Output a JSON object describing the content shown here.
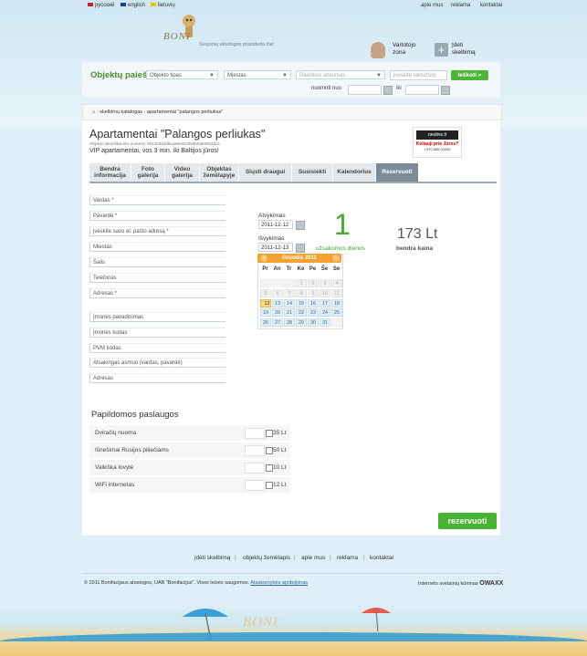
{
  "topbar": {
    "languages": [
      {
        "label": "русский",
        "color": "#cc2222"
      },
      {
        "label": "english",
        "color": "#1e3f8a"
      },
      {
        "label": "lietuvių",
        "color": "#f2c200"
      }
    ],
    "links": [
      "apie mus",
      "reklama",
      "kontaktai"
    ]
  },
  "logo": {
    "text": "BONI",
    "slogan": "Svajonių atostogos prasideda čia!"
  },
  "user": {
    "zone_line1": "Vartotojo",
    "zone_line2": "zona",
    "add_line1": "Įdėti",
    "add_line2": "skelbimą"
  },
  "search": {
    "title": "Objektų paieška",
    "object_type": "Objekto tipas",
    "city": "Miestas",
    "distance": "Paieškos atstumas",
    "keyword_placeholder": "įveskite raktažodį",
    "button": "Ieškoti",
    "from_label": "nuomoti nuo",
    "to_label": "iki"
  },
  "breadcrumb": {
    "home_icon": "home-icon",
    "items": [
      "skelbimų katalogas",
      "apartamentai \"palangos perliukas\""
    ]
  },
  "listing": {
    "title": "Apartamentai \"Palangos perliukas\"",
    "id_line": "Objekto identifikacinis numeris: 8512bd43d9caa6e02c990b0a82652dca",
    "subtitle": "VIP apartamentai, vos 3 min. iki Baltijos jūros!",
    "ad_brand": "neoline.lt",
    "ad_text": "Keliauji prie Jūros?",
    "ad_phone": "+370 685 00030"
  },
  "tabs": [
    {
      "line1": "Bendra",
      "line2": "informacija"
    },
    {
      "line1": "Foto",
      "line2": "galerija"
    },
    {
      "line1": "Video",
      "line2": "galerija"
    },
    {
      "line1": "Objektas",
      "line2": "žemėlapyje"
    },
    {
      "line1": "Siųsti draugui",
      "line2": ""
    },
    {
      "line1": "Susisiekti",
      "line2": ""
    },
    {
      "line1": "Kalendorius",
      "line2": ""
    },
    {
      "line1": "Rezervuoti",
      "line2": ""
    }
  ],
  "form": {
    "fields1": [
      "Vardas *",
      "Pavardė *",
      "įveskite savo el. pašto adresą *",
      "Miestas",
      "Šalis",
      "Telefonas",
      "Adresas *"
    ],
    "fields2": [
      "Įmonės pavadinimas",
      "Įmonės kodas",
      "PVM kodas",
      "Atsakingas asmuo (vardas, pavardė)",
      "Adresas"
    ]
  },
  "booking": {
    "arrival_label": "Atvykimas",
    "arrival_value": "2011-12-12",
    "departure_label": "Išvykimas",
    "departure_value": "2011-12-13",
    "nights": "1",
    "nights_label": "užsakomos dienos",
    "price": "173 Lt",
    "price_label": "bendra kaina"
  },
  "calendar": {
    "title": "Gruodis 2011",
    "weekdays": [
      "Pr",
      "An",
      "Tr",
      "Ke",
      "Pe",
      "Še",
      "Se"
    ],
    "rows": [
      [
        "",
        "",
        "",
        "1",
        "2",
        "3",
        "4"
      ],
      [
        "5",
        "6",
        "7",
        "8",
        "9",
        "10",
        "11"
      ],
      [
        "12",
        "13",
        "14",
        "15",
        "16",
        "17",
        "18"
      ],
      [
        "19",
        "20",
        "21",
        "22",
        "23",
        "24",
        "25"
      ],
      [
        "26",
        "27",
        "28",
        "29",
        "30",
        "31",
        ""
      ]
    ]
  },
  "extras": {
    "title": "Papildomos paslaugos",
    "items": [
      {
        "name": "Dviračių nuoma",
        "price": "35 Lt"
      },
      {
        "name": "Išnešimai Rusijos piliečiams",
        "price": "50 Lt"
      },
      {
        "name": "Vaikiška lovytė",
        "price": "10 Lt"
      },
      {
        "name": "WiFi internetas",
        "price": "12 Lt"
      }
    ]
  },
  "reserve_button": "rezervuoti",
  "footer": {
    "links": [
      "įdėti skelbimą",
      "objektų žemėlapis",
      "apie mus",
      "reklama",
      "kontaktai"
    ],
    "copyright": "© 2011 Bonifacijaus atostogos, UAB \"Bonifacijus\". Visos teisės saugomos.",
    "privacy": "Atsakomybės apribojimas",
    "maker_text": "Interneto svetainių kūrimas",
    "maker_brand": "OWAXX"
  },
  "beach_text": "BONI"
}
